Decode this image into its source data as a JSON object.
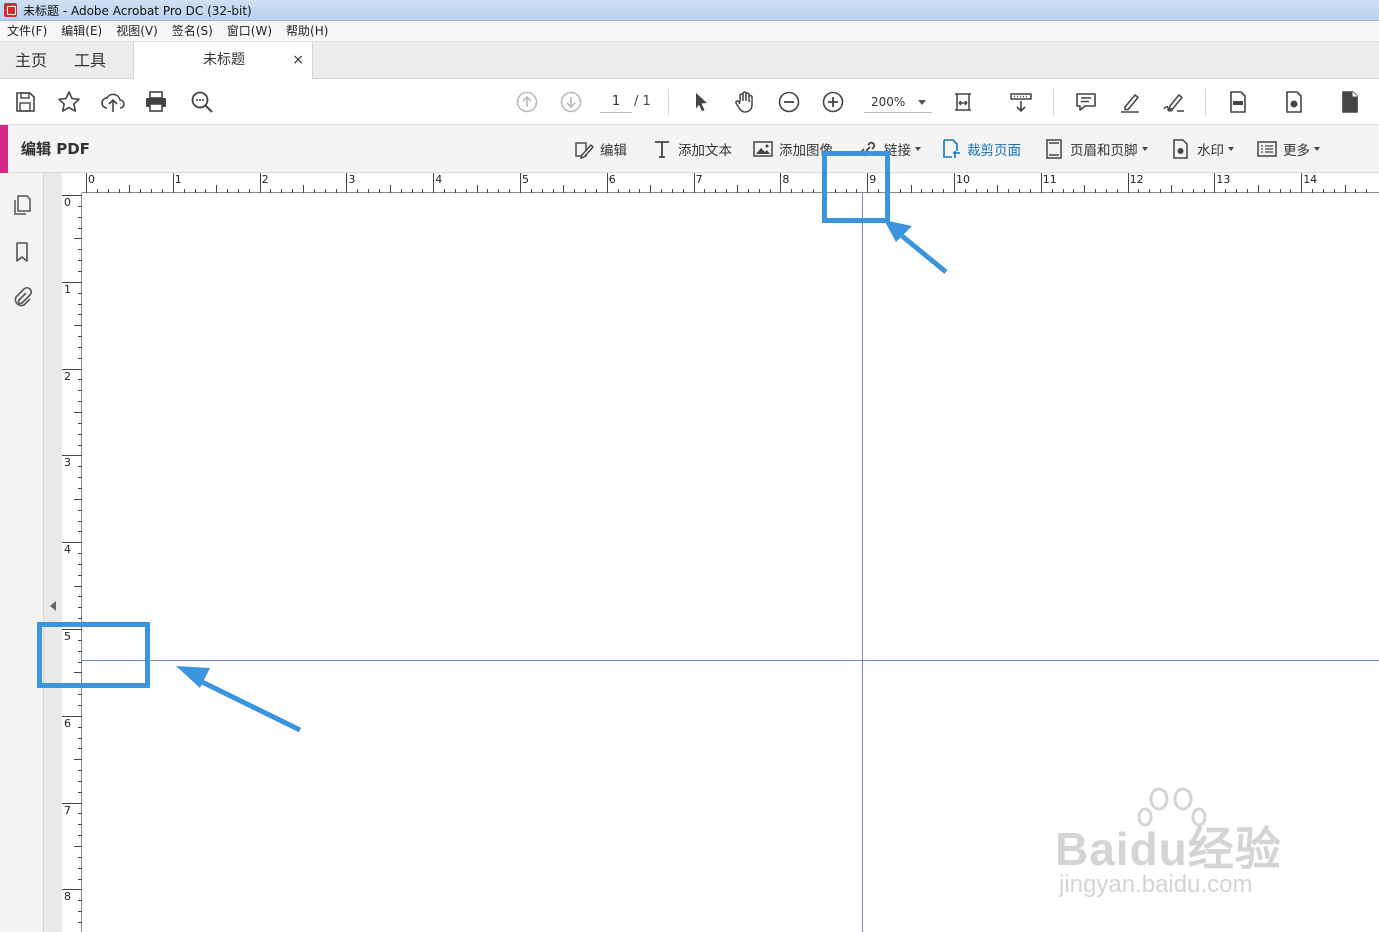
{
  "window": {
    "title": "未标题 - Adobe Acrobat Pro DC (32-bit)"
  },
  "menu": [
    "文件(F)",
    "编辑(E)",
    "视图(V)",
    "签名(S)",
    "窗口(W)",
    "帮助(H)"
  ],
  "tabs": {
    "home": "主页",
    "tools": "工具",
    "document": "未标题",
    "close": "×"
  },
  "toolbar": {
    "page_current": "1",
    "page_total": "/ 1",
    "zoom": "200%",
    "icons": [
      "save-icon",
      "star-icon",
      "upload-icon",
      "print-icon",
      "search-icon",
      "page-up-icon",
      "page-down-icon",
      "select-arrow-icon",
      "hand-icon",
      "zoom-out-icon",
      "zoom-in-icon",
      "fit-page-icon",
      "scroll-mode-icon",
      "comment-icon",
      "highlight-icon",
      "sign-icon",
      "document-icon",
      "export-icon",
      "more-doc-icon"
    ]
  },
  "edit_pdf": {
    "title": "编辑 PDF",
    "tools": [
      {
        "label": "编辑",
        "icon": "edit-icon",
        "dropdown": false,
        "active": false
      },
      {
        "label": "添加文本",
        "icon": "text-icon",
        "dropdown": false,
        "active": false
      },
      {
        "label": "添加图像",
        "icon": "image-icon",
        "dropdown": false,
        "active": false
      },
      {
        "label": "链接",
        "icon": "link-icon",
        "dropdown": true,
        "active": false
      },
      {
        "label": "裁剪页面",
        "icon": "crop-page-icon",
        "dropdown": false,
        "active": true
      },
      {
        "label": "页眉和页脚",
        "icon": "header-footer-icon",
        "dropdown": true,
        "active": false
      },
      {
        "label": "水印",
        "icon": "watermark-icon",
        "dropdown": true,
        "active": false
      },
      {
        "label": "更多",
        "icon": "more-icon",
        "dropdown": true,
        "active": false
      }
    ]
  },
  "leftnav": [
    "pages-icon",
    "bookmark-icon",
    "attachment-icon"
  ],
  "rulers": {
    "horizontal_labels": [
      "0",
      "1",
      "2",
      "3",
      "4",
      "5",
      "6",
      "7",
      "8",
      "9",
      "10",
      "11",
      "12",
      "13",
      "14"
    ],
    "vertical_labels": [
      "0",
      "1",
      "2",
      "3",
      "4",
      "5",
      "6",
      "7",
      "8"
    ]
  },
  "guides": {
    "vertical_at": 9,
    "horizontal_at": 5.4
  },
  "colors": {
    "accent": "#d7268a",
    "annotation": "#3a95de",
    "guide": "#7986cb",
    "active_tool": "#1a73b8"
  },
  "watermark": {
    "line1": "Baidu经验",
    "line2": "jingyan.baidu.com"
  }
}
